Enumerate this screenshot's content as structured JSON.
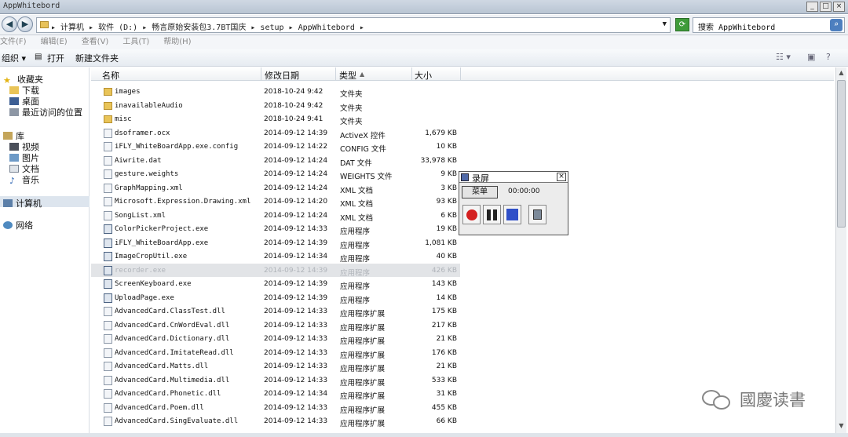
{
  "window": {
    "title": "AppWhitebord",
    "min": "_",
    "max": "□",
    "close": "×"
  },
  "address": {
    "path": "▸ 计算机 ▸ 软件 (D:) ▸ 畅言原始安装包3.7BT国庆 ▸ setup ▸ AppWhitebord ▸",
    "search_placeholder": "搜索 AppWhitebord"
  },
  "menu": [
    "文件(F)",
    "编辑(E)",
    "查看(V)",
    "工具(T)",
    "帮助(H)"
  ],
  "toolbar": {
    "organize": "组织 ▾",
    "open": "打开",
    "new_folder": "新建文件夹"
  },
  "nav": {
    "favorites": "收藏夹",
    "downloads": "下载",
    "desktop": "桌面",
    "recent": "最近访问的位置",
    "library": "库",
    "videos": "视频",
    "pictures": "图片",
    "documents": "文档",
    "music": "音乐",
    "computer": "计算机",
    "network": "网络"
  },
  "columns": {
    "name": "名称",
    "date": "修改日期",
    "type": "类型",
    "size": "大小"
  },
  "files": [
    {
      "name": "images",
      "date": "2018-10-24 9:42",
      "type": "文件夹",
      "size": ""
    },
    {
      "name": "inavailableAudio",
      "date": "2018-10-24 9:42",
      "type": "文件夹",
      "size": ""
    },
    {
      "name": "misc",
      "date": "2018-10-24 9:41",
      "type": "文件夹",
      "size": ""
    },
    {
      "name": "dsoframer.ocx",
      "date": "2014-09-12 14:39",
      "type": "ActiveX 控件",
      "size": "1,679 KB"
    },
    {
      "name": "iFLY_WhiteBoardApp.exe.config",
      "date": "2014-09-12 14:22",
      "type": "CONFIG 文件",
      "size": "10 KB"
    },
    {
      "name": "Aiwrite.dat",
      "date": "2014-09-12 14:24",
      "type": "DAT 文件",
      "size": "33,978 KB"
    },
    {
      "name": "gesture.weights",
      "date": "2014-09-12 14:24",
      "type": "WEIGHTS 文件",
      "size": "9 KB"
    },
    {
      "name": "GraphMapping.xml",
      "date": "2014-09-12 14:24",
      "type": "XML 文档",
      "size": "3 KB"
    },
    {
      "name": "Microsoft.Expression.Drawing.xml",
      "date": "2014-09-12 14:20",
      "type": "XML 文档",
      "size": "93 KB"
    },
    {
      "name": "SongList.xml",
      "date": "2014-09-12 14:24",
      "type": "XML 文档",
      "size": "6 KB"
    },
    {
      "name": "ColorPickerProject.exe",
      "date": "2014-09-12 14:33",
      "type": "应用程序",
      "size": "19 KB"
    },
    {
      "name": "iFLY_WhiteBoardApp.exe",
      "date": "2014-09-12 14:39",
      "type": "应用程序",
      "size": "1,081 KB"
    },
    {
      "name": "ImageCropUtil.exe",
      "date": "2014-09-12 14:34",
      "type": "应用程序",
      "size": "40 KB"
    },
    {
      "name": "recorder.exe",
      "date": "2014-09-12 14:39",
      "type": "应用程序",
      "size": "426 KB"
    },
    {
      "name": "ScreenKeyboard.exe",
      "date": "2014-09-12 14:39",
      "type": "应用程序",
      "size": "143 KB"
    },
    {
      "name": "UploadPage.exe",
      "date": "2014-09-12 14:39",
      "type": "应用程序",
      "size": "14 KB"
    },
    {
      "name": "AdvancedCard.ClassTest.dll",
      "date": "2014-09-12 14:33",
      "type": "应用程序扩展",
      "size": "175 KB"
    },
    {
      "name": "AdvancedCard.CnWordEval.dll",
      "date": "2014-09-12 14:33",
      "type": "应用程序扩展",
      "size": "217 KB"
    },
    {
      "name": "AdvancedCard.Dictionary.dll",
      "date": "2014-09-12 14:33",
      "type": "应用程序扩展",
      "size": "21 KB"
    },
    {
      "name": "AdvancedCard.ImitateRead.dll",
      "date": "2014-09-12 14:33",
      "type": "应用程序扩展",
      "size": "176 KB"
    },
    {
      "name": "AdvancedCard.Matts.dll",
      "date": "2014-09-12 14:33",
      "type": "应用程序扩展",
      "size": "21 KB"
    },
    {
      "name": "AdvancedCard.Multimedia.dll",
      "date": "2014-09-12 14:33",
      "type": "应用程序扩展",
      "size": "533 KB"
    },
    {
      "name": "AdvancedCard.Phonetic.dll",
      "date": "2014-09-12 14:34",
      "type": "应用程序扩展",
      "size": "31 KB"
    },
    {
      "name": "AdvancedCard.Poem.dll",
      "date": "2014-09-12 14:33",
      "type": "应用程序扩展",
      "size": "455 KB"
    },
    {
      "name": "AdvancedCard.SingEvaluate.dll",
      "date": "2014-09-12 14:33",
      "type": "应用程序扩展",
      "size": "66 KB"
    }
  ],
  "recorder": {
    "title": "录屏",
    "menu": "菜单",
    "time": "00:00:00",
    "close": "×"
  },
  "watermark": "國慶读書",
  "colors": {
    "record": "#d42020",
    "stop": "#2f4fc8",
    "folder": "#e9c458"
  }
}
